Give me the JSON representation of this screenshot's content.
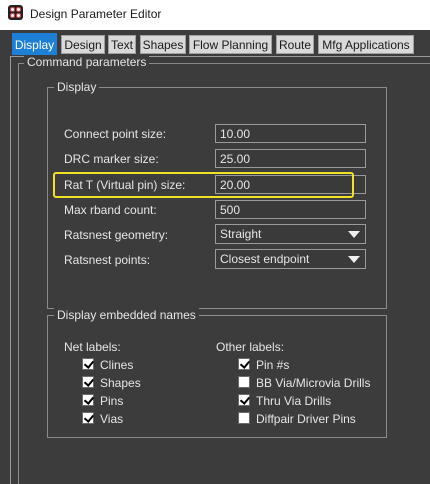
{
  "window": {
    "title": "Design Parameter Editor"
  },
  "tabs": [
    {
      "label": "Display",
      "active": true
    },
    {
      "label": "Design"
    },
    {
      "label": "Text"
    },
    {
      "label": "Shapes"
    },
    {
      "label": "Flow Planning"
    },
    {
      "label": "Route"
    },
    {
      "label": "Mfg Applications"
    }
  ],
  "command_parameters": {
    "title": "Command parameters",
    "display": {
      "title": "Display",
      "fields": [
        {
          "label": "Connect point size:",
          "value": "10.00"
        },
        {
          "label": "DRC marker size:",
          "value": "25.00"
        },
        {
          "label": "Rat T (Virtual pin) size:",
          "value": "20.00"
        },
        {
          "label": "Max rband count:",
          "value": "500"
        }
      ],
      "selects": [
        {
          "label": "Ratsnest geometry:",
          "value": "Straight"
        },
        {
          "label": "Ratsnest points:",
          "value": "Closest endpoint"
        }
      ]
    },
    "embedded_names": {
      "title": "Display embedded names",
      "net_labels": {
        "title": "Net labels:",
        "items": [
          {
            "label": "Clines",
            "checked": true
          },
          {
            "label": "Shapes",
            "checked": true
          },
          {
            "label": "Pins",
            "checked": true
          },
          {
            "label": "Vias",
            "checked": true
          }
        ]
      },
      "other_labels": {
        "title": "Other labels:",
        "items": [
          {
            "label": "Pin #s",
            "checked": true
          },
          {
            "label": "BB Via/Microvia Drills",
            "checked": false
          },
          {
            "label": "Thru Via Drills",
            "checked": true
          },
          {
            "label": "Diffpair Driver Pins",
            "checked": false
          }
        ]
      }
    }
  },
  "colors": {
    "background": "#3c3c3c",
    "active_tab": "#1e7fd6",
    "highlight_box": "#f2e227"
  }
}
